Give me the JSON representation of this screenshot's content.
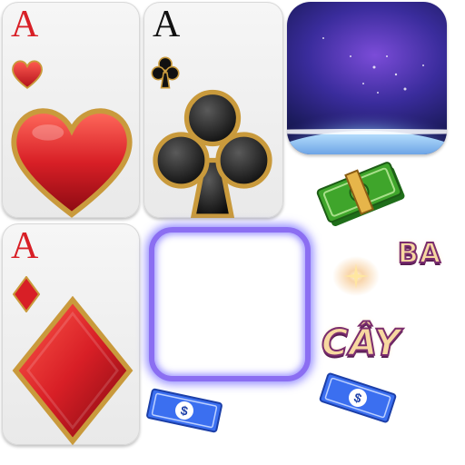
{
  "cards": {
    "ace_hearts": {
      "rank": "A",
      "suit": "heart"
    },
    "ace_clubs": {
      "rank": "A",
      "suit": "club"
    },
    "ace_diamonds": {
      "rank": "A",
      "suit": "diamond"
    }
  },
  "labels": {
    "word_ba": "BA",
    "word_cay": "CÂY"
  },
  "money": {
    "symbol": "$"
  },
  "colors": {
    "red_suit": "#d81f26",
    "black_suit": "#111111",
    "gold_rim": "#c99a3c",
    "frame_glow": "#8b6ef2",
    "cash_green": "#3fa52b",
    "cash_blue": "#3b6ff0"
  }
}
